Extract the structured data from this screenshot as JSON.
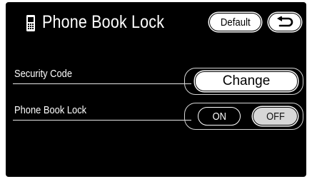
{
  "header": {
    "title": "Phone Book Lock",
    "icon": "phone-icon",
    "default_label": "Default",
    "back_icon": "back-arrow-icon"
  },
  "rows": {
    "security_code": {
      "label": "Security Code",
      "button_label": "Change"
    },
    "phone_book_lock": {
      "label": "Phone Book Lock",
      "on_label": "ON",
      "off_label": "OFF",
      "selected": "OFF"
    }
  },
  "colors": {
    "screen_background": "#000000",
    "text": "#ffffff",
    "button_face": "#ffffff",
    "selected_button_face": "#d7d7d7",
    "divider": "#e6e6e6"
  }
}
